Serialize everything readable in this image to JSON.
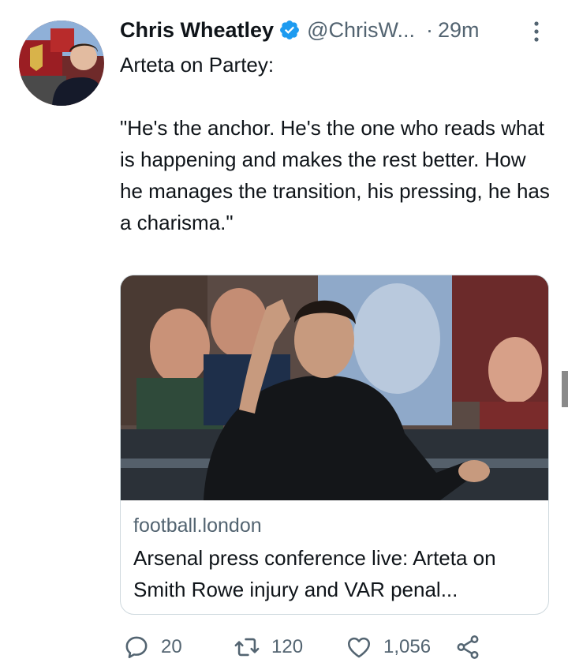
{
  "tweet": {
    "author_name": "Chris Wheatley",
    "author_handle": "@ChrisW...",
    "separator": "·",
    "time": "29m",
    "text": "Arteta on Partey:\n\n\"He's the anchor. He's the one who reads what is happening and makes the rest better. How he manages the transition, his pressing, he has a charisma.\"",
    "verified_icon": "verified-badge-icon",
    "more_icon": "more-vertical-icon"
  },
  "card": {
    "domain": "football.london",
    "title": "Arsenal press conference live: Arteta on Smith Rowe injury and VAR penal..."
  },
  "actions": {
    "reply_count": "20",
    "retweet_count": "120",
    "like_count": "1,056",
    "icons": [
      "reply-icon",
      "retweet-icon",
      "like-icon",
      "share-icon"
    ]
  },
  "colors": {
    "text_primary": "#0f1419",
    "text_secondary": "#536471",
    "verified_blue": "#1d9bf0",
    "border": "#cfd9de"
  }
}
